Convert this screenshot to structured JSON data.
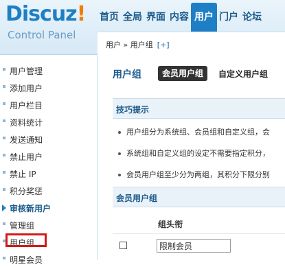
{
  "logo": {
    "main": "Discuz",
    "bang": "!",
    "sub": "Control Panel"
  },
  "topnav": [
    "首页",
    "全局",
    "界面",
    "内容",
    "用户",
    "门户",
    "论坛"
  ],
  "topnav_active_index": 4,
  "breadcrumb": {
    "path": "用户 » 用户组",
    "add": "[+]"
  },
  "sidebar": {
    "items": [
      "用户管理",
      "添加用户",
      "用户栏目",
      "资料统计",
      "发送通知",
      "禁止用户",
      "禁止 IP",
      "积分奖惩"
    ],
    "group_label": "审核新用户",
    "items2": [
      "管理组",
      "用户组",
      "明星会员"
    ]
  },
  "main": {
    "title": "用户组",
    "tab_member": "会员用户组",
    "tab_custom": "自定义用户组",
    "tips_title": "技巧提示",
    "tips": [
      "用户组分为系统组、会员组和自定义组，会",
      "系统组和自定义组的设定不需要指定积分，",
      "会员用户组至少分为两组，其积分下限分别"
    ],
    "member_section_title": "会员用户组",
    "column_header": "组头衔",
    "row_value": "限制会员"
  },
  "colors": {
    "accent": "#1f7fc4",
    "highlight_box": "#d01a1a",
    "logo_bang": "#f07c00"
  }
}
